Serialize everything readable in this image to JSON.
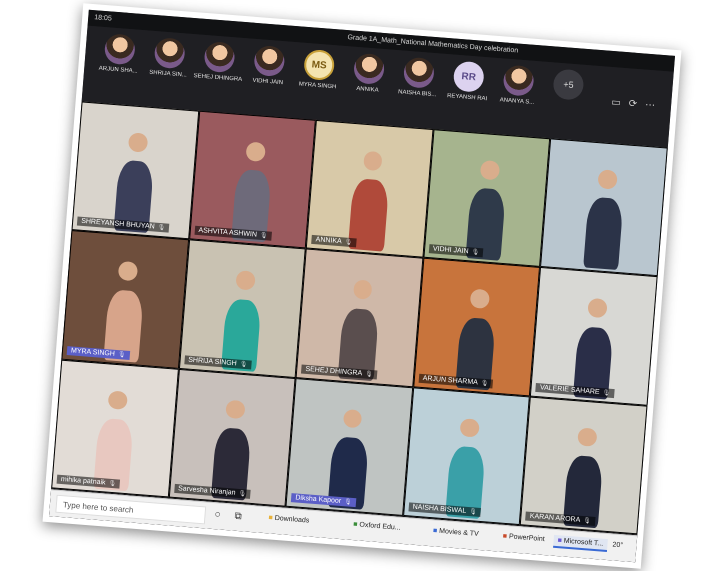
{
  "window": {
    "time": "18:05",
    "title": "Grade 1A_Math_National Mathematics Day celebration"
  },
  "participants_strip": [
    {
      "name": "ARJUN SHA...",
      "avatar": "photo"
    },
    {
      "name": "SHRIJA SIN...",
      "avatar": "photo"
    },
    {
      "name": "SEHEJ DHINGRA",
      "avatar": "photo"
    },
    {
      "name": "VIDHI JAIN",
      "avatar": "photo"
    },
    {
      "name": "MYRA SINGH",
      "avatar": "initials",
      "initials": "MS"
    },
    {
      "name": "ANNIKA",
      "avatar": "photo"
    },
    {
      "name": "NAISHA BIS...",
      "avatar": "photo"
    },
    {
      "name": "REYANSH RAI",
      "avatar": "initials",
      "initials": "RR"
    },
    {
      "name": "ANANYA S...",
      "avatar": "photo"
    },
    {
      "name": "",
      "avatar": "more",
      "initials": "+5"
    }
  ],
  "video_tiles": [
    {
      "name": "SHREYANSH BHUYAN",
      "bg": "#d9d4cc",
      "figure": "#3b3f5a",
      "highlight": false
    },
    {
      "name": "ASHVITA ASHWIN",
      "bg": "#9a5a5e",
      "figure": "#6e6a7a",
      "highlight": false
    },
    {
      "name": "ANNIKA",
      "bg": "#d8c9a8",
      "figure": "#b04a3a",
      "highlight": false
    },
    {
      "name": "VIDHI JAIN",
      "bg": "#a6b48e",
      "figure": "#2f3a4a",
      "highlight": false
    },
    {
      "name": "",
      "bg": "#b9c6cf",
      "figure": "#2b3348",
      "highlight": false
    },
    {
      "name": "MYRA SINGH",
      "bg": "#6e4e3c",
      "figure": "#d7a48a",
      "highlight": true
    },
    {
      "name": "SHRIJA SINGH",
      "bg": "#c9c2b2",
      "figure": "#2aa89a",
      "highlight": false
    },
    {
      "name": "SEHEJ DHINGRA",
      "bg": "#cfb8a8",
      "figure": "#5a4e4e",
      "highlight": false
    },
    {
      "name": "ARJUN SHARMA",
      "bg": "#c8743c",
      "figure": "#2d3340",
      "highlight": false
    },
    {
      "name": "VALERIE SAHARE",
      "bg": "#d8d8d4",
      "figure": "#2a2e48",
      "highlight": false
    },
    {
      "name": "mihika patnaik",
      "bg": "#e2dcd6",
      "figure": "#e8c8c0",
      "highlight": false
    },
    {
      "name": "Sarvesha Niranjan",
      "bg": "#c8c0bb",
      "figure": "#2c2a38",
      "highlight": false
    },
    {
      "name": "Diksha Kapoor",
      "bg": "#bfc4c2",
      "figure": "#1f2a4a",
      "highlight": true
    },
    {
      "name": "NAISHA BISWAL",
      "bg": "#bcd0d8",
      "figure": "#3aa0a8",
      "highlight": false
    },
    {
      "name": "KARAN ARORA",
      "bg": "#d2d0c8",
      "figure": "#23283a",
      "highlight": false
    }
  ],
  "taskbar": {
    "search_placeholder": "Type here to search",
    "apps": [
      {
        "label": "Downloads",
        "icon": "folder-icon"
      },
      {
        "label": "Oxford Edu...",
        "icon": "chrome-icon"
      },
      {
        "label": "Movies & TV",
        "icon": "movies-icon"
      },
      {
        "label": "PowerPoint",
        "icon": "powerpoint-icon"
      },
      {
        "label": "Microsoft T...",
        "icon": "teams-icon"
      }
    ],
    "temperature": "20°"
  }
}
